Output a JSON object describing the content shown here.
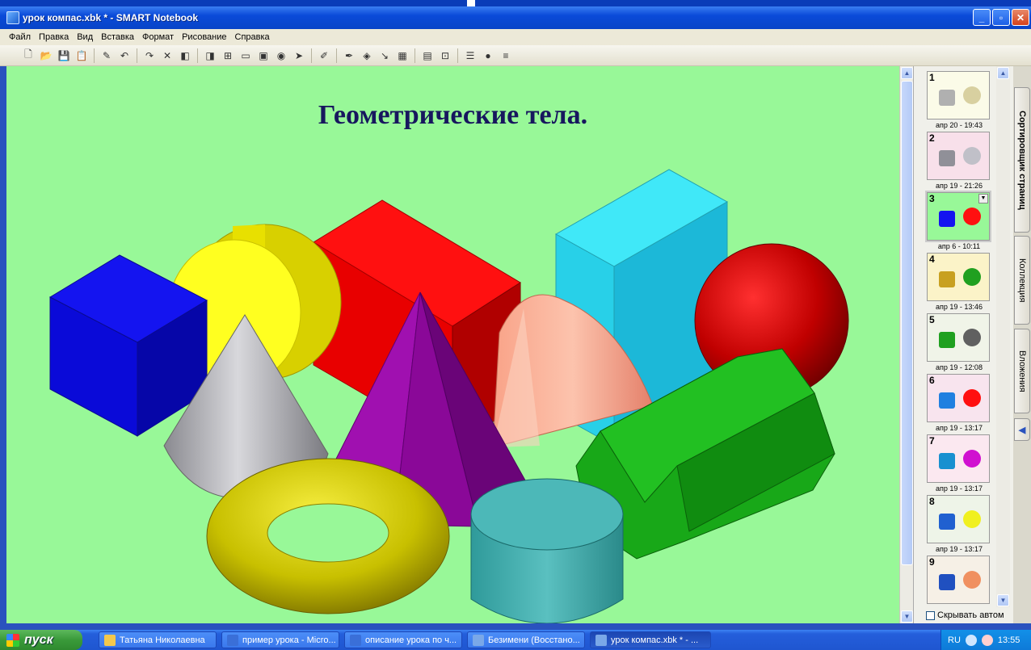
{
  "window": {
    "title": "урок компас.xbk * - SMART Notebook"
  },
  "menu": [
    "Файл",
    "Правка",
    "Вид",
    "Вставка",
    "Формат",
    "Рисование",
    "Справка"
  ],
  "toolbar": {
    "icons": [
      "new-file-icon",
      "open-folder-icon",
      "save-icon",
      "paste-icon",
      "magic-pen-icon",
      "undo-icon",
      "redo-icon",
      "delete-icon",
      "prev-page-icon",
      "next-page-icon",
      "add-page-icon",
      "screen-shade-icon",
      "full-screen-icon",
      "camera-icon",
      "select-arrow-icon",
      "pen-icon",
      "creative-pen-icon",
      "eraser-icon",
      "line-icon",
      "fill-color-icon",
      "properties-icon",
      "group-icon",
      "table-icon",
      "shape-icon",
      "more-icon"
    ],
    "glyphs": [
      "🗋",
      "📂",
      "💾",
      "📋",
      "✎",
      "↶",
      "↷",
      "✕",
      "◧",
      "◨",
      "⊞",
      "▭",
      "▣",
      "◉",
      "➤",
      "✐",
      "✒",
      "◈",
      "↘",
      "▦",
      "▤",
      "⊡",
      "☰",
      "●",
      "≡"
    ]
  },
  "slide": {
    "title": "Геометрические тела."
  },
  "sorter": {
    "pages": [
      {
        "num": "1",
        "date": "апр 20 - 19:43",
        "bg": "#fbfbe8"
      },
      {
        "num": "2",
        "date": "апр 19 - 21:26",
        "bg": "#f8e0ea"
      },
      {
        "num": "3",
        "date": "апр 6 - 10:11",
        "bg": "#98f898"
      },
      {
        "num": "4",
        "date": "апр 19 - 13:46",
        "bg": "#fbf3c8"
      },
      {
        "num": "5",
        "date": "апр 19 - 12:08",
        "bg": "#f0f4e8"
      },
      {
        "num": "6",
        "date": "апр 19 - 13:17",
        "bg": "#f8e4ee"
      },
      {
        "num": "7",
        "date": "апр 19 - 13:17",
        "bg": "#fbe8f0"
      },
      {
        "num": "8",
        "date": "апр 19 - 13:17",
        "bg": "#eef4e8"
      },
      {
        "num": "9",
        "date": "",
        "bg": "#f6f0e6"
      }
    ],
    "hide_label": "Скрывать автом"
  },
  "sidetabs": [
    "Сортировщик страниц",
    "Коллекция",
    "Вложения"
  ],
  "taskbar": {
    "start": "пуск",
    "tasks": [
      {
        "label": "Татьяна Николаевна",
        "color": "#f3c84c"
      },
      {
        "label": "пример урока - Micro...",
        "color": "#3a6fd8"
      },
      {
        "label": "описание урока по ч...",
        "color": "#3a6fd8"
      },
      {
        "label": "Безимени (Восстано...",
        "color": "#7aa8e8"
      },
      {
        "label": "урок компас.xbk * - ...",
        "color": "#7aa8e8"
      }
    ],
    "lang": "RU",
    "clock": "13:55"
  }
}
